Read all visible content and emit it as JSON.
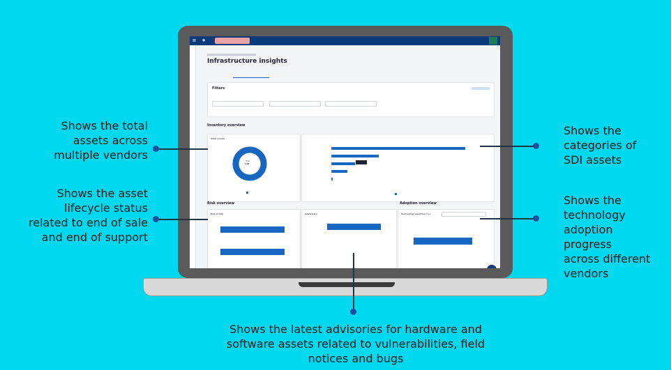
{
  "callouts": {
    "total_assets": "Shows the total\nassets across\nmultiple vendors",
    "lifecycle": "Shows the asset\nlifecycle status\nrelated to end of sale\nand end of support",
    "sdi": "Shows the\ncategories of\nSDI assets",
    "adoption": "Shows the\ntechnology\nadoption\nprogress\nacross different\nvendors",
    "advisories": "Shows the latest advisories for hardware and\nsoftware assets related to vulnerabilities, field\nnotices and bugs"
  },
  "app": {
    "page_title": "Infrastructure insights",
    "filters_title": "Filters",
    "inventory_title": "Inventory overview",
    "total_assets_title": "Total assets",
    "donut_center_label": "Total",
    "donut_center_value": "5.4K",
    "risk_title": "Risk overview",
    "eol_title": "End of Life",
    "advisories_title": "Advisories",
    "adoption_title": "Adoption overview",
    "tech_adoption_title": "Technology adoption (%)"
  },
  "colors": {
    "accent": "#1766c2",
    "navy": "#0b3a7a",
    "background": "#00d8ef"
  },
  "chart_data": [
    {
      "type": "pie",
      "title": "Total assets",
      "values": [
        100
      ]
    },
    {
      "type": "bar",
      "title": "SDI assets",
      "values": [
        1.0,
        0.33,
        0.14,
        0.11,
        0.01
      ]
    },
    {
      "type": "bar",
      "title": "End of Life",
      "values": [
        1.0,
        1.0
      ]
    },
    {
      "type": "bar",
      "title": "Advisories",
      "values": [
        1.0,
        0,
        0
      ]
    },
    {
      "type": "bar",
      "title": "Technology adoption (%)",
      "values": [
        0.85
      ]
    }
  ]
}
